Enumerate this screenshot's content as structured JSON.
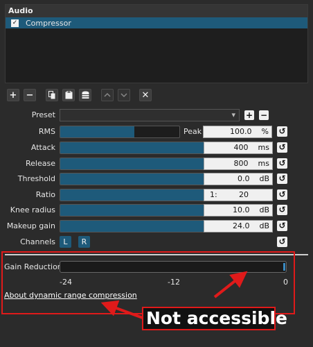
{
  "audio": {
    "header": "Audio",
    "filters": [
      {
        "checked_mark": "✓",
        "name": "Compressor"
      }
    ]
  },
  "toolbar": {
    "add": "+",
    "remove": "−",
    "copy_icon": "copy-icon",
    "paste_icon": "paste-icon",
    "presets_icon": "stack-icon",
    "up": "up-chevron",
    "down": "down-chevron",
    "close": "✕"
  },
  "preset": {
    "label": "Preset",
    "value": "",
    "add": "+",
    "remove": "−"
  },
  "params": {
    "rms": {
      "label": "RMS",
      "fill": 0.62,
      "peak_label": "Peak",
      "value": "100.0",
      "unit": "%"
    },
    "attack": {
      "label": "Attack",
      "fill": 0.7,
      "value": "400",
      "unit": "ms"
    },
    "release": {
      "label": "Release",
      "fill": 0.7,
      "value": "800",
      "unit": "ms"
    },
    "threshold": {
      "label": "Threshold",
      "fill": 0.7,
      "value": "0.0",
      "unit": "dB"
    },
    "ratio": {
      "label": "Ratio",
      "fill": 0.7,
      "prefix": "1:",
      "value": "20"
    },
    "knee": {
      "label": "Knee radius",
      "fill": 0.7,
      "value": "10.0",
      "unit": "dB"
    },
    "makeup": {
      "label": "Makeup gain",
      "fill": 0.7,
      "value": "24.0",
      "unit": "dB"
    }
  },
  "channels": {
    "label": "Channels",
    "left": "L",
    "right": "R"
  },
  "gain_reduction": {
    "label": "Gain Reduction",
    "ticks": [
      "-24",
      "-12",
      "0"
    ],
    "level": 0.0
  },
  "link": "About dynamic range compression",
  "annotation": {
    "text": "Not accessible",
    "color": "#e01a1a"
  },
  "colors": {
    "accent": "#1e5a7a",
    "background": "#2b2b2b"
  }
}
